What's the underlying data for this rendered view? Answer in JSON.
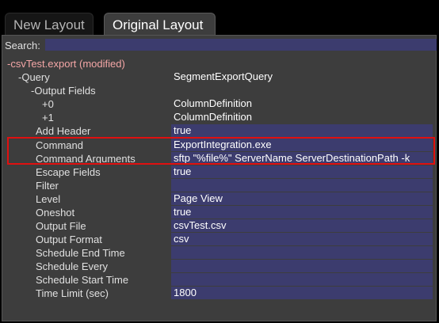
{
  "tabs": [
    {
      "label": "New Layout",
      "active": false
    },
    {
      "label": "Original Layout",
      "active": true
    }
  ],
  "search": {
    "label": "Search:",
    "value": ""
  },
  "tree": {
    "root": {
      "label": "-csvTest.export (modified)"
    },
    "query": {
      "label": "-Query",
      "value": "SegmentExportQuery"
    },
    "output_fields": {
      "label": "-Output Fields"
    },
    "field0": {
      "label": "+0",
      "value": "ColumnDefinition"
    },
    "field1": {
      "label": "+1",
      "value": "ColumnDefinition"
    }
  },
  "properties": [
    {
      "name": "Add Header",
      "value": "true"
    },
    {
      "name": "Command",
      "value": "ExportIntegration.exe"
    },
    {
      "name": "Command Arguments",
      "value": "sftp \"%file%\" ServerName ServerDestinationPath -k"
    },
    {
      "name": "Escape Fields",
      "value": "true"
    },
    {
      "name": "Filter",
      "value": ""
    },
    {
      "name": "Level",
      "value": "Page View"
    },
    {
      "name": "Oneshot",
      "value": "true"
    },
    {
      "name": "Output File",
      "value": "csvTest.csv"
    },
    {
      "name": "Output Format",
      "value": "csv"
    },
    {
      "name": "Schedule End Time",
      "value": ""
    },
    {
      "name": "Schedule Every",
      "value": ""
    },
    {
      "name": "Schedule Start Time",
      "value": ""
    },
    {
      "name": "Time Limit (sec)",
      "value": "1800"
    }
  ],
  "colors": {
    "field_bg": "#3c3c6e",
    "panel_bg": "#3d3d3d",
    "highlight": "#e01010",
    "root_text": "#f4a6a6"
  }
}
